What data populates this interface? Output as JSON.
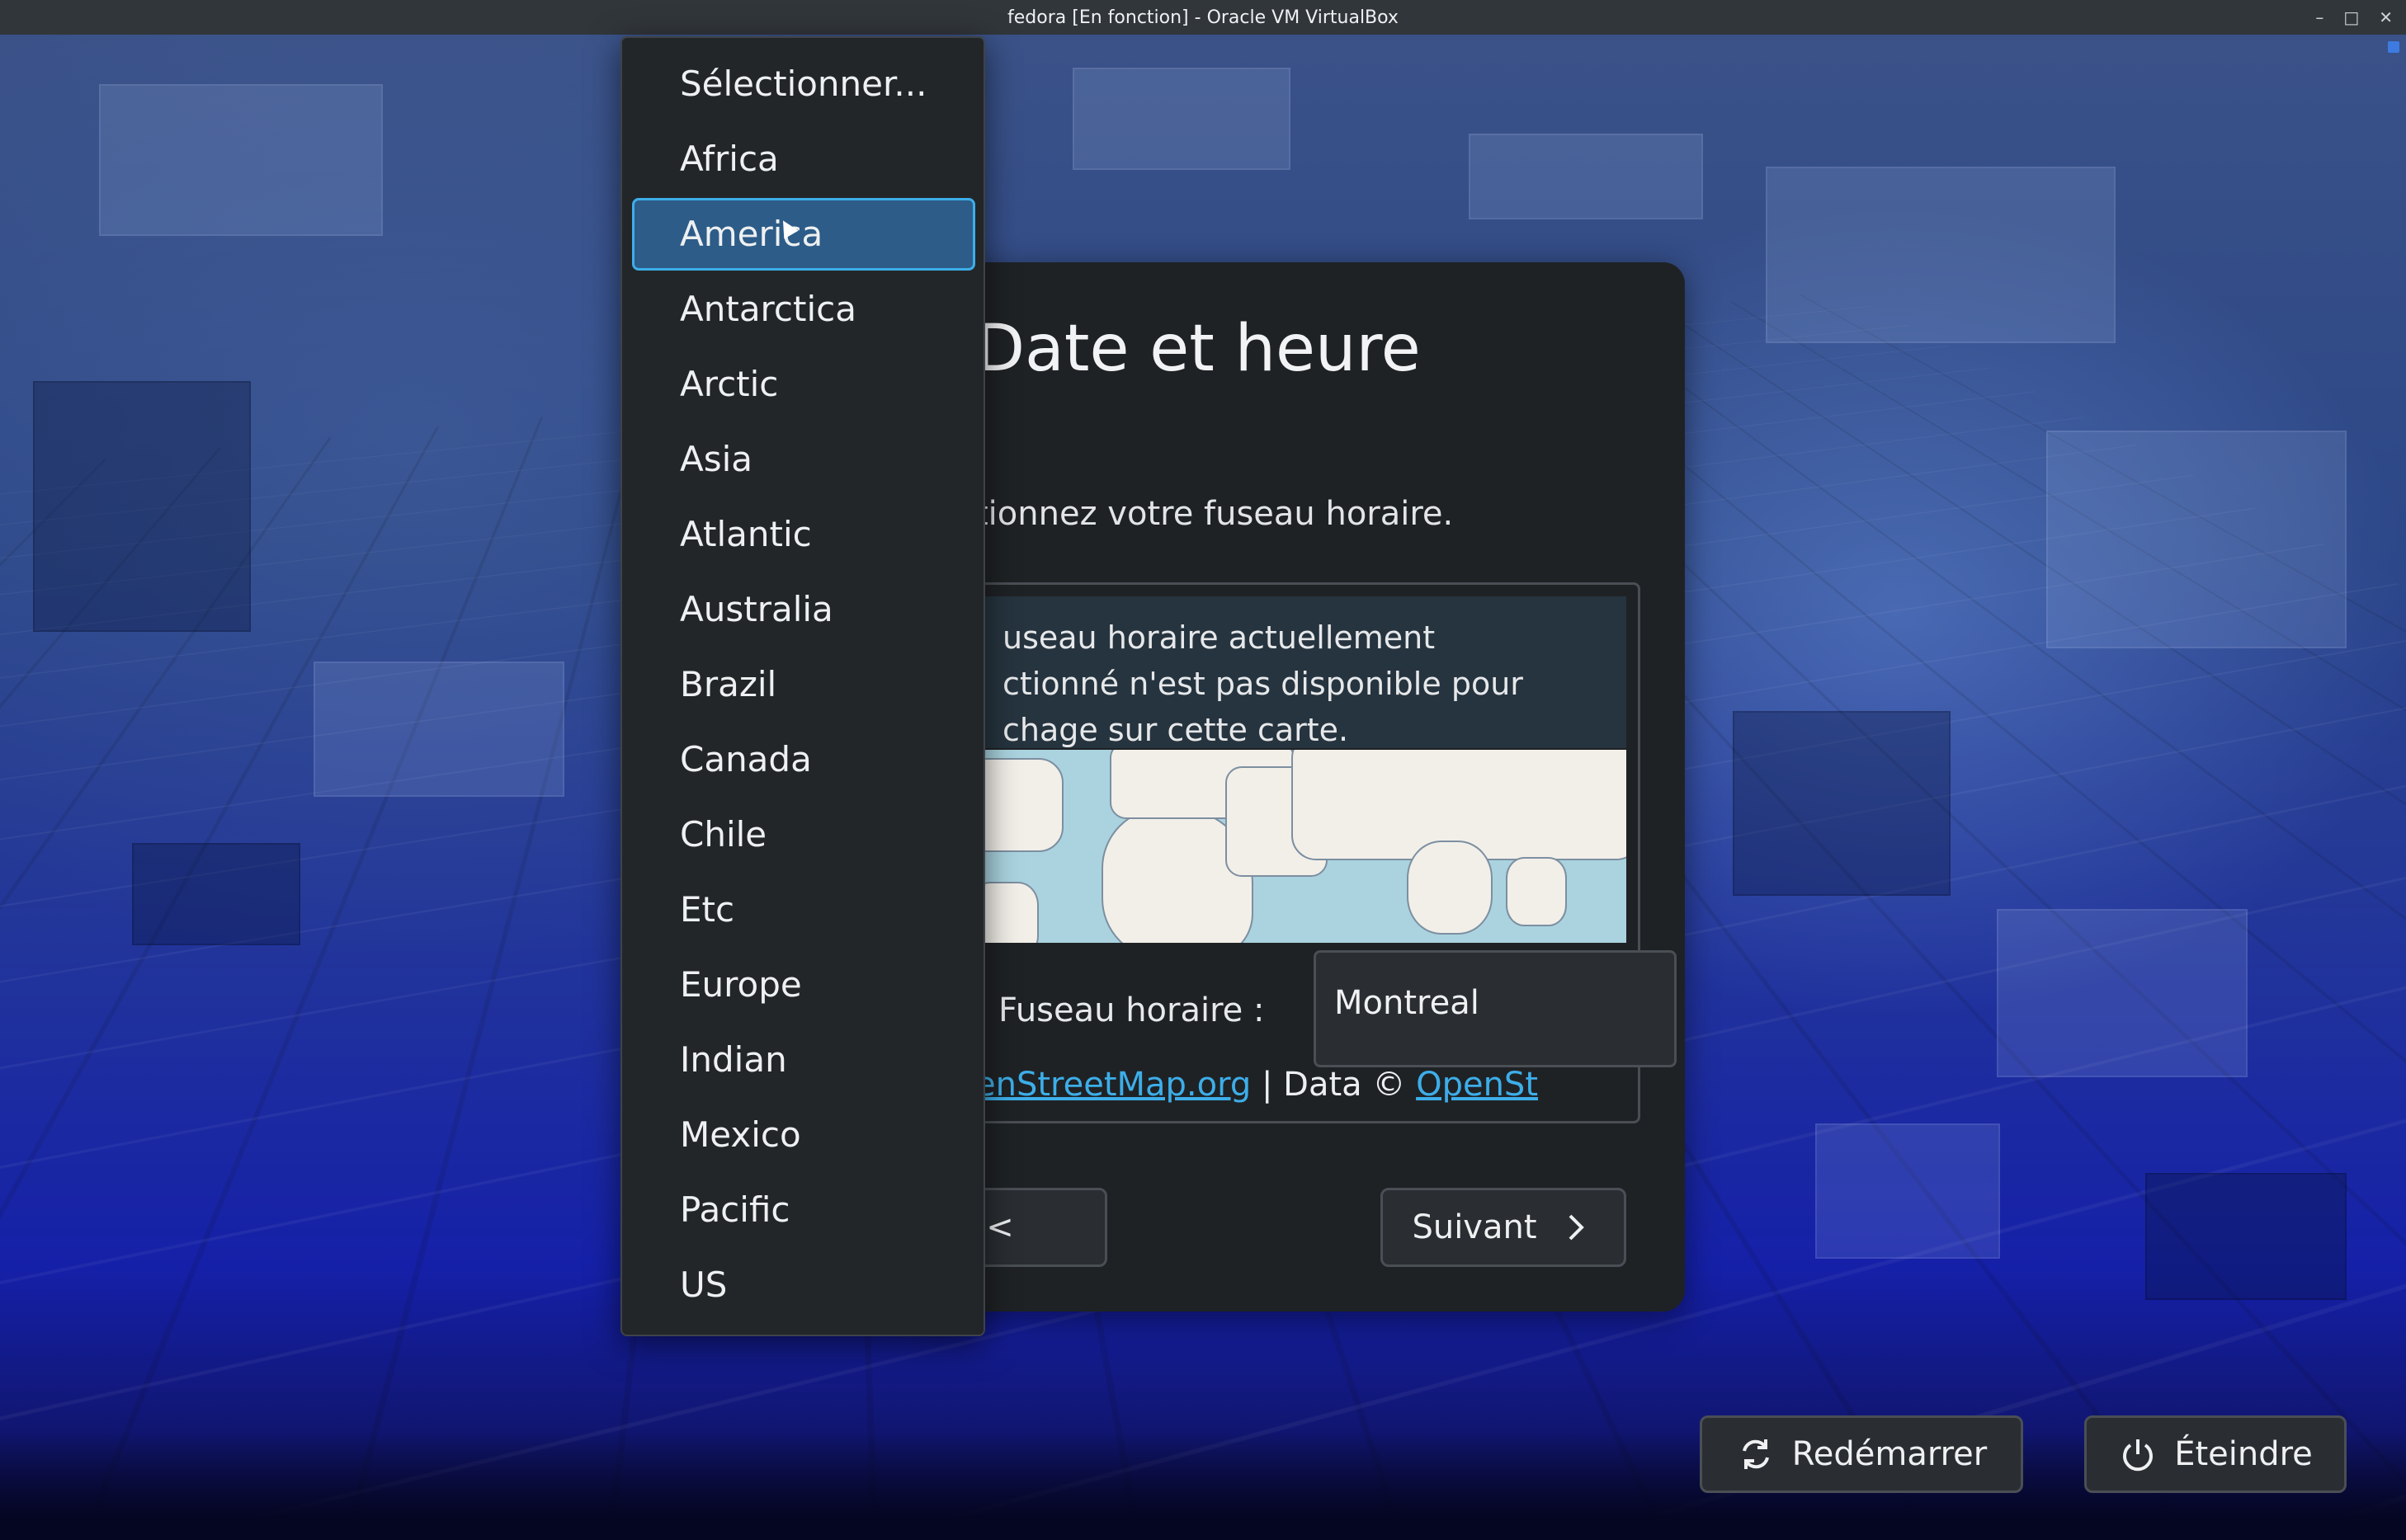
{
  "window": {
    "title": "fedora [En fonction] - Oracle VM VirtualBox",
    "controls": {
      "minimize": "–",
      "maximize": "□",
      "close": "✕"
    }
  },
  "dialog": {
    "title": "Date et heure",
    "subtitle": "tionnez votre fuseau horaire.",
    "map_warning": "useau horaire actuellement ctionné n'est pas disponible pour chage sur cette carte.",
    "map_warning_lines": [
      "useau horaire actuellement",
      "ctionné n'est pas disponible pour",
      "chage sur cette carte."
    ],
    "timezone_label": "Fuseau horaire :",
    "timezone_value": "Montreal",
    "attribution": {
      "link1": "enStreetMap.org",
      "separator": " | Data © ",
      "link2": "OpenSt"
    },
    "back_label": "<",
    "next_label": "Suivant",
    "next_icon": "chevron-right-icon"
  },
  "region_dropdown": {
    "selected": "America",
    "items": [
      "Sélectionner...",
      "Africa",
      "America",
      "Antarctica",
      "Arctic",
      "Asia",
      "Atlantic",
      "Australia",
      "Brazil",
      "Canada",
      "Chile",
      "Etc",
      "Europe",
      "Indian",
      "Mexico",
      "Pacific",
      "US"
    ]
  },
  "footer": {
    "restart_label": "Redémarrer",
    "restart_icon": "refresh-icon",
    "shutdown_label": "Éteindre",
    "shutdown_icon": "power-icon"
  },
  "colors": {
    "accent": "#3daee9",
    "selected_bg": "#2d5c88",
    "dialog_bg": "#1f2225",
    "titlebar_bg": "#31363b"
  }
}
